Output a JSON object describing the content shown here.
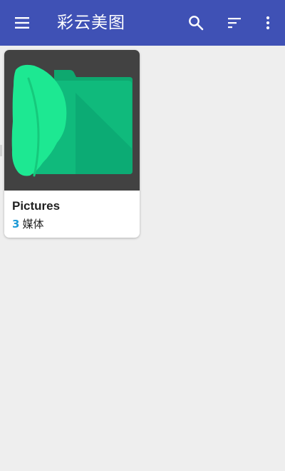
{
  "app_bar": {
    "title": "彩云美图",
    "background": "#3f51b5",
    "icons": {
      "menu": "menu-icon",
      "search": "search-icon",
      "sort": "sort-icon",
      "more": "more-vert-icon"
    }
  },
  "albums": [
    {
      "name": "Pictures",
      "count": "3",
      "unit": "媒体",
      "thumbnail_icon": "feather-folder-icon",
      "count_color": "#1e9bd7"
    }
  ]
}
